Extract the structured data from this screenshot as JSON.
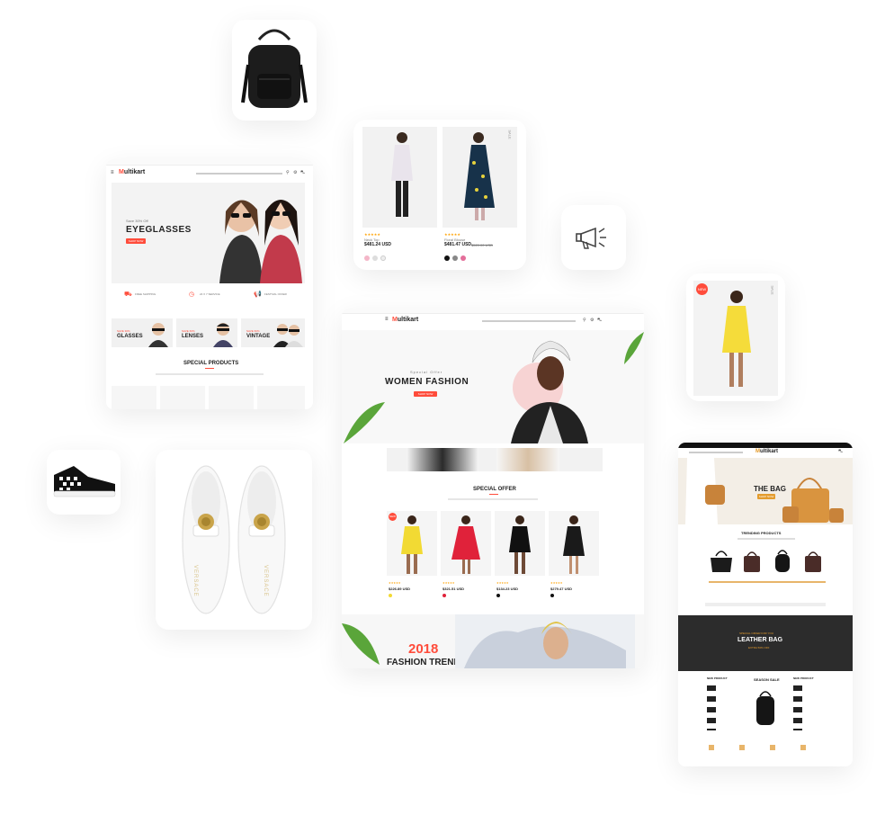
{
  "brand": {
    "logo_letter": "M",
    "logo_rest": "ultikart",
    "accent": "#ff4c3b"
  },
  "eyewear_site": {
    "hero_prefix": "Save 30% Off",
    "hero_title": "EYEGLASSES",
    "hero_button": "SHOP NOW",
    "services": [
      "FREE SHIPPING",
      "24 X 7 SERVICE",
      "FESTIVAL OFFER"
    ],
    "categories": [
      {
        "tag": "SAVE 30%",
        "label": "GLASSES"
      },
      {
        "tag": "SAVE 60%",
        "label": "LENSES"
      },
      {
        "tag": "SAVE 60%",
        "label": "VINTAGE"
      }
    ],
    "section_title": "SPECIAL PRODUCTS"
  },
  "fashion_cards": {
    "products": [
      {
        "name": "Neck Top",
        "price": "$481.24 USD"
      },
      {
        "name": "Floral Blouse",
        "price": "$481.47 USD",
        "old_price": "$520.00 USD"
      }
    ],
    "sale_label": "SALE"
  },
  "single_product": {
    "badge": "NEW",
    "side_label": "SALE"
  },
  "main_site": {
    "hero_prefix": "Special Offer",
    "hero_title": "WOMEN FASHION",
    "hero_button": "SHOP NOW",
    "section_title": "SPECIAL OFFER",
    "badge": "NEW",
    "prices": [
      "$226.89 USD",
      "$321.51 USD",
      "$134.23 USD",
      "$279.47 USD"
    ],
    "banner_year": "2018",
    "banner_title": "FASHION TRENDS"
  },
  "bag_site": {
    "hero_title": "THE BAG",
    "hero_button": "SHOP NOW",
    "section_title": "TRENDING PRODUCTS",
    "promo_prefix": "SPECIAL OFFER FOR YOU",
    "promo_title": "LEATHER BAG",
    "promo_sub": "EXTRA 50% OFF",
    "sale_title": "SEASON SALE",
    "list_titles": [
      "NEW PRODUCT",
      "NEW PRODUCT"
    ]
  },
  "shoes": {
    "brand_text": "VERSACE"
  },
  "colors": {
    "pink": "#ff4c3b",
    "yellow": "#f7e040",
    "green": "#3a9c3a",
    "dark": "#222222"
  }
}
